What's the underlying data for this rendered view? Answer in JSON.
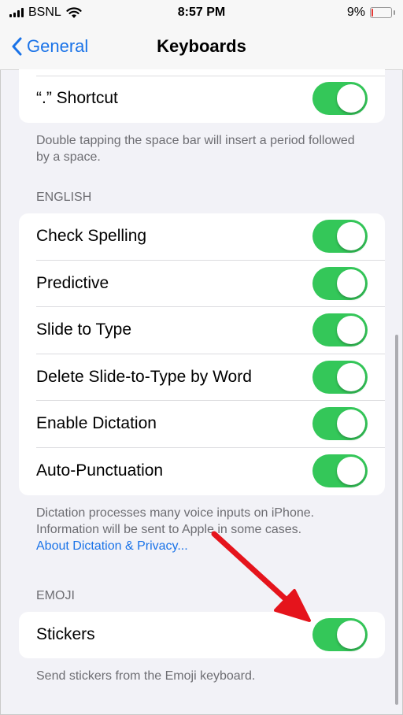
{
  "status": {
    "carrier": "BSNL",
    "time": "8:57 PM",
    "battery_percent": "9%",
    "battery_level": 0.09,
    "icons": [
      "signal-icon",
      "wifi-icon",
      "battery-icon"
    ]
  },
  "nav": {
    "back_label": "General",
    "title": "Keyboards"
  },
  "shortcut_section": {
    "row_label": "“.” Shortcut",
    "toggle_on": true,
    "footnote": "Double tapping the space bar will insert a period followed by a space."
  },
  "english_section": {
    "header": "ENGLISH",
    "rows": [
      {
        "label": "Check Spelling",
        "on": true
      },
      {
        "label": "Predictive",
        "on": true
      },
      {
        "label": "Slide to Type",
        "on": true
      },
      {
        "label": "Delete Slide-to-Type by Word",
        "on": true
      },
      {
        "label": "Enable Dictation",
        "on": true
      },
      {
        "label": "Auto-Punctuation",
        "on": true
      }
    ],
    "footnote": "Dictation processes many voice inputs on iPhone. Information will be sent to Apple in some cases.",
    "link": "About Dictation & Privacy..."
  },
  "emoji_section": {
    "header": "EMOJI",
    "row_label": "Stickers",
    "toggle_on": true,
    "footnote": "Send stickers from the Emoji keyboard."
  },
  "colors": {
    "accent": "#1a73e8",
    "toggle_on": "#34c759",
    "background": "#f2f2f7",
    "annotation_arrow": "#e5141c"
  }
}
